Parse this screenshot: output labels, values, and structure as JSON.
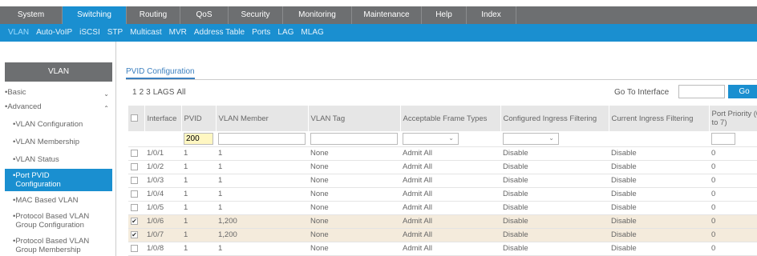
{
  "top_tabs": [
    "System",
    "Switching",
    "Routing",
    "QoS",
    "Security",
    "Monitoring",
    "Maintenance",
    "Help",
    "Index"
  ],
  "top_active": "Switching",
  "sub_tabs": [
    "VLAN",
    "Auto-VoIP",
    "iSCSI",
    "STP",
    "Multicast",
    "MVR",
    "Address Table",
    "Ports",
    "LAG",
    "MLAG"
  ],
  "sub_active": "VLAN",
  "sidebar": {
    "title": "VLAN",
    "basic": "Basic",
    "advanced": "Advanced",
    "items": [
      "VLAN Configuration",
      "VLAN Membership",
      "VLAN Status",
      "Port PVID Configuration",
      "MAC Based VLAN",
      "Protocol Based VLAN Group Configuration",
      "Protocol Based VLAN Group Membership"
    ],
    "selected": "Port PVID Configuration"
  },
  "page": {
    "title": "PVID Configuration",
    "pager": [
      "1",
      "2",
      "3",
      "LAGS",
      "All"
    ],
    "goto_label": "Go To Interface",
    "goto_button": "Go"
  },
  "table": {
    "headers": [
      "Interface",
      "PVID",
      "VLAN Member",
      "VLAN Tag",
      "Acceptable Frame Types",
      "Configured Ingress Filtering",
      "Current Ingress Filtering",
      "Port Priority (0 to 7)"
    ],
    "filter_pvid": "200",
    "rows": [
      {
        "checked": false,
        "interface": "1/0/1",
        "pvid": "1",
        "member": "1",
        "tag": "None",
        "frame": "Admit All",
        "cfg": "Disable",
        "cur": "Disable",
        "prio": "0"
      },
      {
        "checked": false,
        "interface": "1/0/2",
        "pvid": "1",
        "member": "1",
        "tag": "None",
        "frame": "Admit All",
        "cfg": "Disable",
        "cur": "Disable",
        "prio": "0"
      },
      {
        "checked": false,
        "interface": "1/0/3",
        "pvid": "1",
        "member": "1",
        "tag": "None",
        "frame": "Admit All",
        "cfg": "Disable",
        "cur": "Disable",
        "prio": "0"
      },
      {
        "checked": false,
        "interface": "1/0/4",
        "pvid": "1",
        "member": "1",
        "tag": "None",
        "frame": "Admit All",
        "cfg": "Disable",
        "cur": "Disable",
        "prio": "0"
      },
      {
        "checked": false,
        "interface": "1/0/5",
        "pvid": "1",
        "member": "1",
        "tag": "None",
        "frame": "Admit All",
        "cfg": "Disable",
        "cur": "Disable",
        "prio": "0"
      },
      {
        "checked": true,
        "interface": "1/0/6",
        "pvid": "1",
        "member": "1,200",
        "tag": "None",
        "frame": "Admit All",
        "cfg": "Disable",
        "cur": "Disable",
        "prio": "0"
      },
      {
        "checked": true,
        "interface": "1/0/7",
        "pvid": "1",
        "member": "1,200",
        "tag": "None",
        "frame": "Admit All",
        "cfg": "Disable",
        "cur": "Disable",
        "prio": "0"
      },
      {
        "checked": false,
        "interface": "1/0/8",
        "pvid": "1",
        "member": "1",
        "tag": "None",
        "frame": "Admit All",
        "cfg": "Disable",
        "cur": "Disable",
        "prio": "0"
      }
    ]
  },
  "colors": {
    "accent": "#1a8fd0",
    "topbar": "#6d6f71",
    "highlight_row": "#f4ebdc",
    "pvid_filter": "#fff7c2"
  },
  "icons": {
    "dropdown": "chevron-down-icon",
    "expand": "chevron-down-icon",
    "collapse": "chevron-up-icon"
  }
}
